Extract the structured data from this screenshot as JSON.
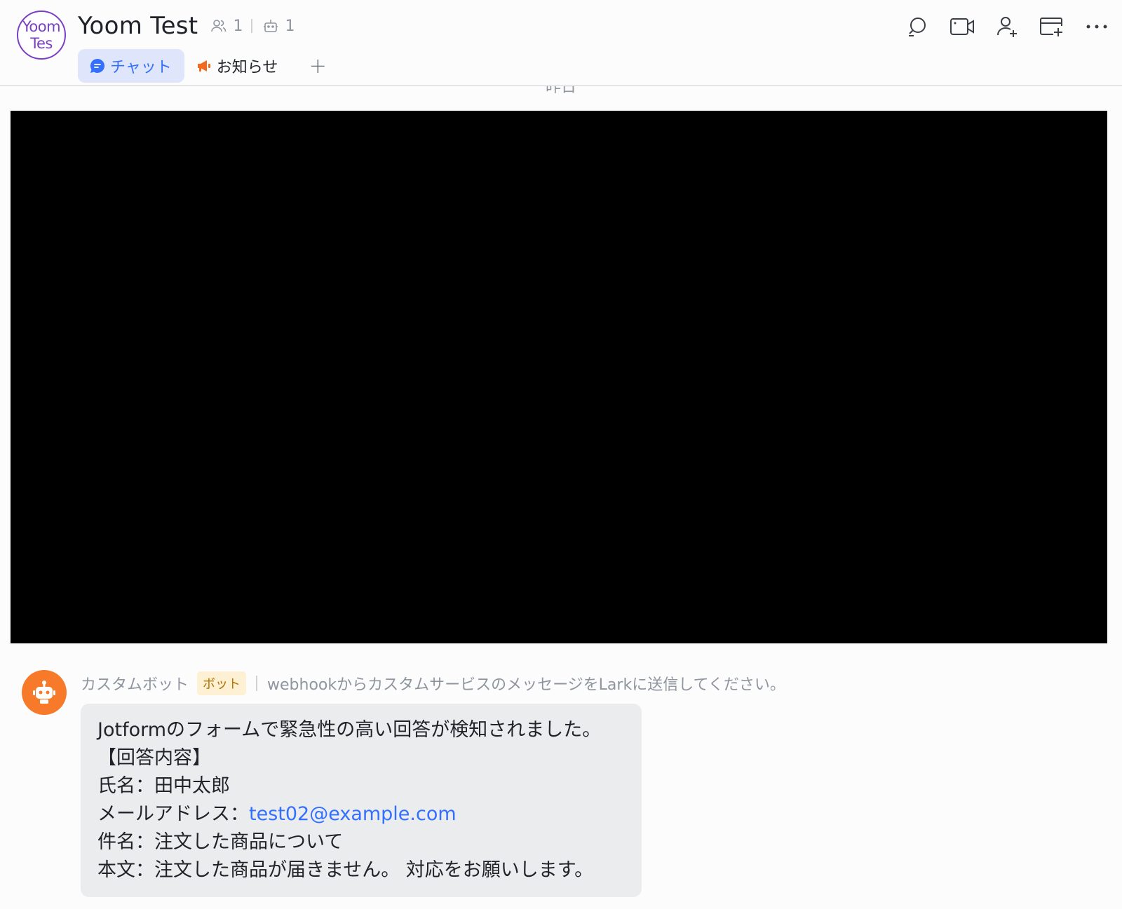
{
  "header": {
    "avatar_lines": [
      "Yoom",
      "Tes"
    ],
    "title": "Yoom Test",
    "member_count": "1",
    "bot_count": "1",
    "tabs": [
      {
        "label": "チャット",
        "active": true,
        "icon": "chat-bubble-icon"
      },
      {
        "label": "お知らせ",
        "active": false,
        "icon": "megaphone-icon"
      }
    ],
    "add_tab": "+",
    "toolbar_icons": [
      "search-icon",
      "video-call-icon",
      "add-member-icon",
      "add-tab-icon",
      "more-icon"
    ]
  },
  "timeline": {
    "date_divider": "昨日"
  },
  "message": {
    "sender": "カスタムボット",
    "badge": "ボット",
    "description": "webhookからカスタムサービスのメッセージをLarkに送信してください。",
    "lines": {
      "l1": "Jotformのフォームで緊急性の高い回答が検知されました。",
      "l2": "【回答内容】",
      "l3": "氏名：田中太郎",
      "l4_prefix": "メールアドレス：",
      "l4_link": "test02@example.com",
      "l5": "件名：注文した商品について",
      "l6": "本文：注文した商品が届きません。 対応をお願いします。"
    }
  },
  "colors": {
    "accent": "#3370ff",
    "avatar_border": "#7b3fc6",
    "bot_avatar": "#f77a2a",
    "badge_bg": "#fdf0d3",
    "badge_text": "#b27300",
    "bubble_bg": "#ebecee",
    "megaphone": "#f26b1d"
  }
}
